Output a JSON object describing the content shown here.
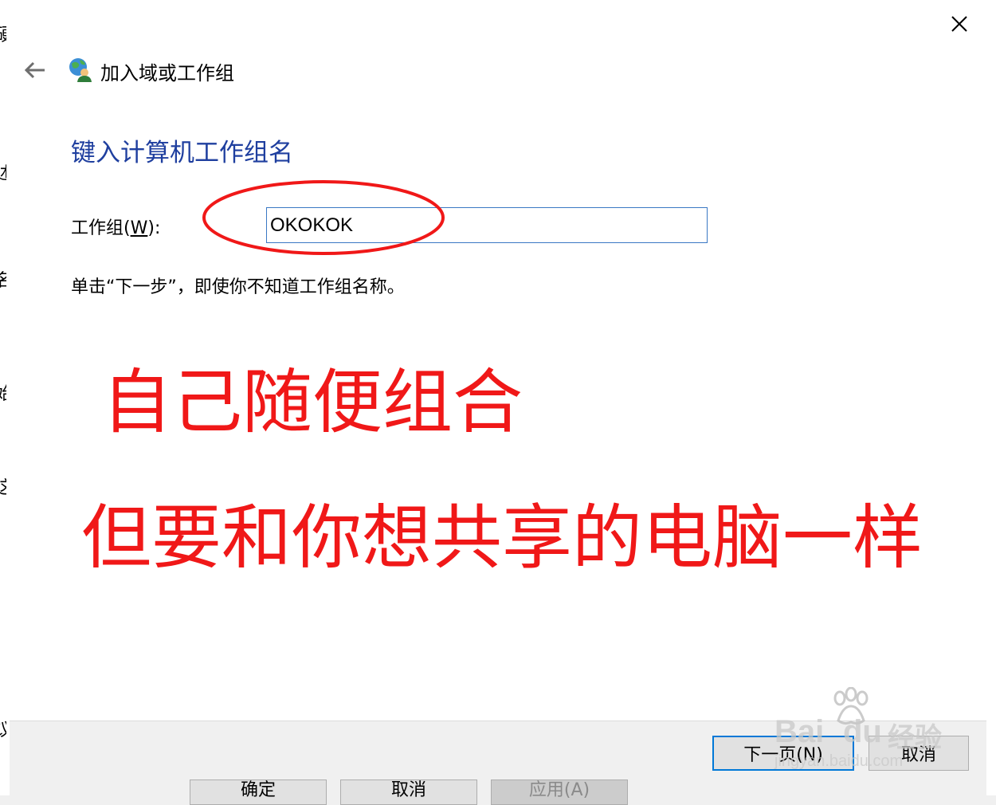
{
  "background": {
    "left_chars": [
      "硬",
      "述",
      "名",
      "始",
      "这",
      "议"
    ],
    "bottom_buttons": [
      "确定",
      "取消",
      "应用(A)"
    ]
  },
  "dialog": {
    "title": "加入域或工作组",
    "heading": "键入计算机工作组名",
    "workgroup_label": "工作组(W):",
    "workgroup_value": "OKOKOK",
    "hint": "单击“下一步”，即使你不知道工作组名称。",
    "next_button": "下一页(N)",
    "cancel_button": "取消"
  },
  "annotations": {
    "line1": "自己随便组合",
    "line2": "但要和你想共享的电脑一样"
  },
  "watermark": {
    "brand": "Bai",
    "brand2": "du",
    "jingyan": "经验",
    "url": "jingyan.baidu.com"
  },
  "colors": {
    "heading": "#1f3f9f",
    "annotation": "#f01818",
    "input_border": "#3a78c4",
    "primary_border": "#0078d7"
  },
  "icons": [
    "back-arrow-icon",
    "network-user-icon",
    "close-icon"
  ]
}
